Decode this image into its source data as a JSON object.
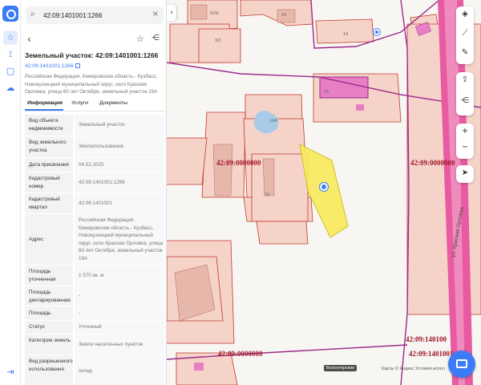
{
  "rail": {
    "icons": [
      "logo",
      "star-icon",
      "route-icon",
      "layers-square-icon",
      "cloud-icon",
      "logout-icon"
    ]
  },
  "search": {
    "value": "42:09:1401001:1266",
    "search_icon": "⌕",
    "clear_icon": "×"
  },
  "toolbar": {
    "back_icon": "‹",
    "favorite_icon": "☆",
    "share_icon": "⋲"
  },
  "object": {
    "title": "Земельный участок: 42:09:1401001:1266",
    "cadastral_link": "42:09:1401001:1266",
    "address": "Российская Федерация, Кемеровская область - Кузбасс, Новокузнецкий муниципальный округ, село Красная Орловка, улица 60 лет Октября, земельный участок 19А"
  },
  "tabs": [
    {
      "label": "Информация",
      "active": true
    },
    {
      "label": "Услуги",
      "active": false
    },
    {
      "label": "Документы",
      "active": false
    }
  ],
  "info_rows": [
    {
      "key": "Вид объекта недвижимости",
      "value": "Земельный участок"
    },
    {
      "key": "Вид земельного участка",
      "value": "Землепользование"
    },
    {
      "key": "Дата присвоения",
      "value": "04.02.2025"
    },
    {
      "key": "Кадастровый номер",
      "value": "42:09:1401001:1266"
    },
    {
      "key": "Кадастровый квартал",
      "value": "42:09:1401001"
    },
    {
      "key": "Адрес",
      "value": "Российская Федерация, Кемеровская область - Кузбасс, Новокузнецкий муниципальный округ, село Красная Орловка, улица 60 лет Октября, земельный участок 19А"
    },
    {
      "key": "Площадь уточненная",
      "value": "1 570 кв. м"
    },
    {
      "key": "Площадь декларированная",
      "value": "-"
    },
    {
      "key": "Площадь",
      "value": "-"
    },
    {
      "key": "Статус",
      "value": "Учтенный"
    },
    {
      "key": "Категория земель",
      "value": "Земли населенных пунктов"
    },
    {
      "key": "Вид разрешенного использования",
      "value": "склад"
    }
  ],
  "map": {
    "collapse_icon": "‹",
    "cadastral_labels": [
      "42:09:0000000",
      "42:09:0000000",
      "42:09:140100",
      "42:09:1401001",
      "42:09:0000000"
    ],
    "parcel_numbers": [
      "6/26",
      "24",
      "3/2",
      "14",
      "15",
      "16А",
      "19"
    ],
    "street_label": "ул. Красная Орловка",
    "controls_top": [
      "layers-icon",
      "measure-icon",
      "edit-icon"
    ],
    "controls_mid": [
      "upload-icon",
      "share-nodes-icon"
    ],
    "zoom_in": "+",
    "zoom_out": "−",
    "locate_icon": "➤",
    "attribution_box": "Волонтерские",
    "attribution": "Карты © Яндекс   Условия испол",
    "colors": {
      "parcel_fill": "#f6d3c9",
      "parcel_stroke": "#c0392b",
      "selected_fill": "#f7ea5a",
      "boundary": "#9b2a8c",
      "road": "#e0559c",
      "building": "#e77fc5"
    }
  }
}
